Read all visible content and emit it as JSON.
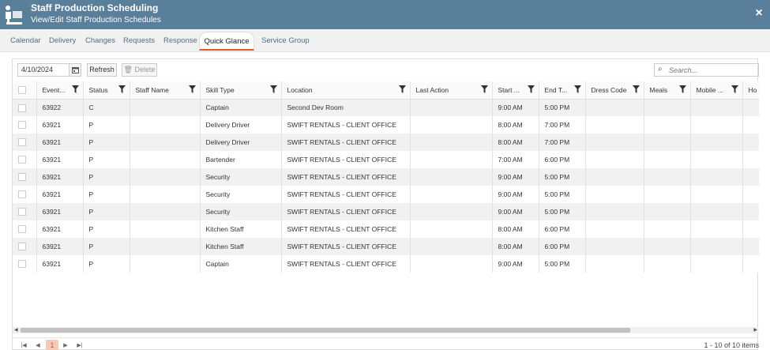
{
  "header": {
    "title": "Staff Production Scheduling",
    "subtitle": "View/Edit Staff Production Schedules",
    "close_label": "×"
  },
  "tabs": [
    {
      "label": "Calendar"
    },
    {
      "label": "Delivery"
    },
    {
      "label": "Changes"
    },
    {
      "label": "Requests"
    },
    {
      "label": "Response"
    },
    {
      "label": "Quick Glance",
      "active": true
    },
    {
      "label": "Service Group"
    }
  ],
  "toolbar": {
    "date_value": "4/10/2024",
    "refresh_label": "Refresh",
    "delete_label": "Delete",
    "search_placeholder": "Search..."
  },
  "columns": [
    "Event...",
    "Status",
    "Staff Name",
    "Skill Type",
    "Location",
    "Last Action",
    "Start ...",
    "End T...",
    "Dress Code",
    "Meals",
    "Mobile ...",
    "Ho"
  ],
  "rows": [
    {
      "event": "63922",
      "status": "C",
      "staff": "",
      "skill": "Captain",
      "location": "Second Dev Room",
      "last": "",
      "start": "9:00 AM",
      "end": "5:00 PM"
    },
    {
      "event": "63921",
      "status": "P",
      "staff": "",
      "skill": "Delivery Driver",
      "location": "SWIFT RENTALS - CLIENT OFFICE",
      "last": "",
      "start": "8:00 AM",
      "end": "7:00 PM"
    },
    {
      "event": "63921",
      "status": "P",
      "staff": "",
      "skill": "Delivery Driver",
      "location": "SWIFT RENTALS - CLIENT OFFICE",
      "last": "",
      "start": "8:00 AM",
      "end": "7:00 PM"
    },
    {
      "event": "63921",
      "status": "P",
      "staff": "",
      "skill": "Bartender",
      "location": "SWIFT RENTALS - CLIENT OFFICE",
      "last": "",
      "start": "7:00 AM",
      "end": "6:00 PM"
    },
    {
      "event": "63921",
      "status": "P",
      "staff": "",
      "skill": "Security",
      "location": "SWIFT RENTALS - CLIENT OFFICE",
      "last": "",
      "start": "9:00 AM",
      "end": "5:00 PM"
    },
    {
      "event": "63921",
      "status": "P",
      "staff": "",
      "skill": "Security",
      "location": "SWIFT RENTALS - CLIENT OFFICE",
      "last": "",
      "start": "9:00 AM",
      "end": "5:00 PM"
    },
    {
      "event": "63921",
      "status": "P",
      "staff": "",
      "skill": "Security",
      "location": "SWIFT RENTALS - CLIENT OFFICE",
      "last": "",
      "start": "9:00 AM",
      "end": "5:00 PM"
    },
    {
      "event": "63921",
      "status": "P",
      "staff": "",
      "skill": "Kitchen Staff",
      "location": "SWIFT RENTALS - CLIENT OFFICE",
      "last": "",
      "start": "8:00 AM",
      "end": "6:00 PM"
    },
    {
      "event": "63921",
      "status": "P",
      "staff": "",
      "skill": "Kitchen Staff",
      "location": "SWIFT RENTALS - CLIENT OFFICE",
      "last": "",
      "start": "8:00 AM",
      "end": "6:00 PM"
    },
    {
      "event": "63921",
      "status": "P",
      "staff": "",
      "skill": "Captain",
      "location": "SWIFT RENTALS - CLIENT OFFICE",
      "last": "",
      "start": "9:00 AM",
      "end": "5:00 PM"
    }
  ],
  "pager": {
    "current_page": "1",
    "info": "1 - 10 of 10 items"
  },
  "colors": {
    "header_bg": "#5a7f9a",
    "accent": "#e05a2b"
  }
}
